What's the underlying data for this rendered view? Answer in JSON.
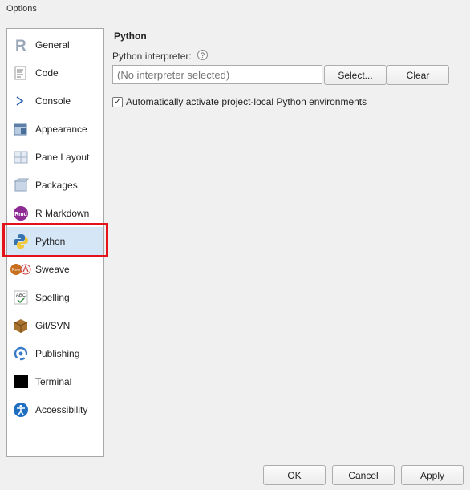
{
  "window": {
    "title": "Options"
  },
  "sidebar": {
    "items": [
      {
        "label": "General",
        "icon": "r-logo-icon"
      },
      {
        "label": "Code",
        "icon": "code-document-icon"
      },
      {
        "label": "Console",
        "icon": "console-prompt-icon"
      },
      {
        "label": "Appearance",
        "icon": "appearance-icon"
      },
      {
        "label": "Pane Layout",
        "icon": "pane-layout-icon"
      },
      {
        "label": "Packages",
        "icon": "packages-icon"
      },
      {
        "label": "R Markdown",
        "icon": "rmd-icon"
      },
      {
        "label": "Python",
        "icon": "python-icon"
      },
      {
        "label": "Sweave",
        "icon": "sweave-icon"
      },
      {
        "label": "Spelling",
        "icon": "spelling-icon"
      },
      {
        "label": "Git/SVN",
        "icon": "git-svn-icon"
      },
      {
        "label": "Publishing",
        "icon": "publishing-icon"
      },
      {
        "label": "Terminal",
        "icon": "terminal-icon"
      },
      {
        "label": "Accessibility",
        "icon": "accessibility-icon"
      }
    ],
    "selected": "Python",
    "highlight_color": "#e3121b"
  },
  "pane": {
    "title": "Python",
    "interpreter_label": "Python interpreter:",
    "help": "?",
    "interpreter_placeholder": "(No interpreter selected)",
    "select_label": "Select...",
    "clear_label": "Clear",
    "auto_activate_label": "Automatically activate project-local Python environments",
    "auto_activate_checked": true,
    "check_mark": "✓"
  },
  "footer": {
    "ok_label": "OK",
    "cancel_label": "Cancel",
    "apply_label": "Apply"
  }
}
